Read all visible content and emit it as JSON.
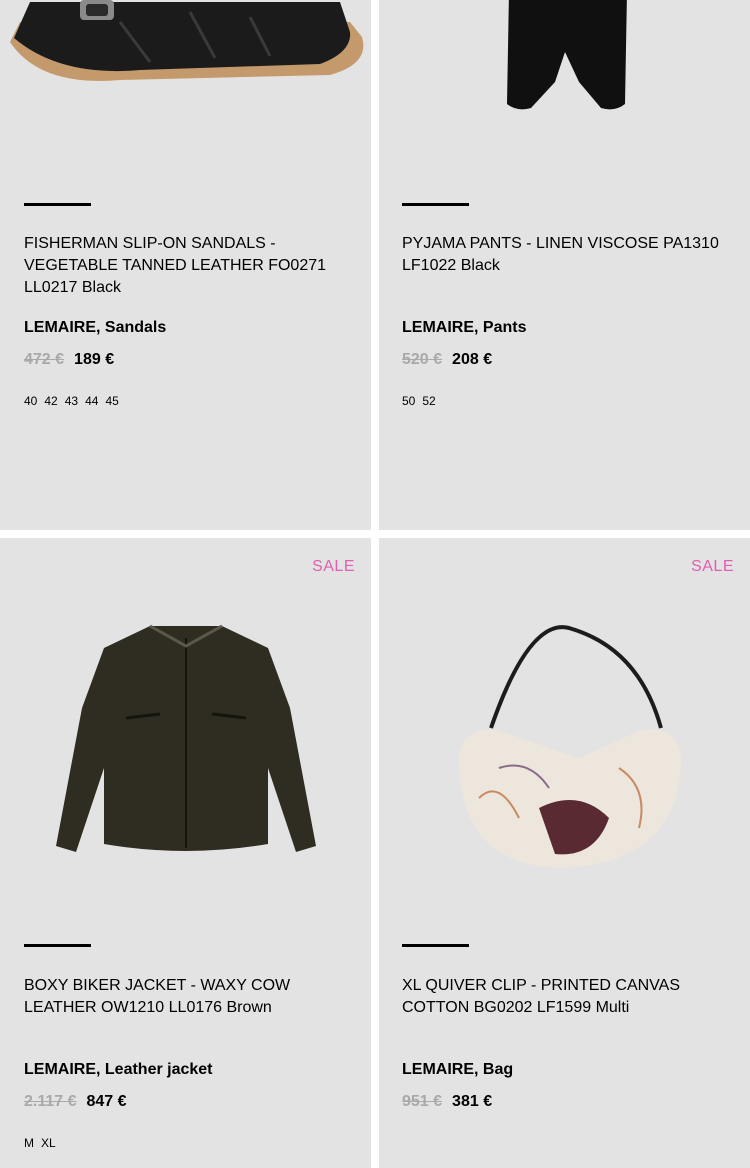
{
  "products": [
    {
      "title": "FISHERMAN SLIP-ON SANDALS - VEGETABLE TANNED LEATHER FO0271 LL0217 Black",
      "brand_line": "LEMAIRE, Sandals",
      "old_price": "472 €",
      "price": "189 €",
      "sizes": [
        "40",
        "42",
        "43",
        "44",
        "45"
      ],
      "sale": null
    },
    {
      "title": "PYJAMA PANTS - LINEN VISCOSE PA1310 LF1022 Black",
      "brand_line": "LEMAIRE, Pants",
      "old_price": "520 €",
      "price": "208 €",
      "sizes": [
        "50",
        "52"
      ],
      "sale": null
    },
    {
      "title": "BOXY BIKER JACKET - WAXY COW LEATHER OW1210 LL0176 Brown",
      "brand_line": "LEMAIRE, Leather jacket",
      "old_price": "2.117 €",
      "price": "847 €",
      "sizes": [
        "M",
        "XL"
      ],
      "sale": "SALE"
    },
    {
      "title": "XL QUIVER CLIP - PRINTED CANVAS COTTON BG0202 LF1599 Multi",
      "brand_line": "LEMAIRE, Bag",
      "old_price": "951 €",
      "price": "381 €",
      "sizes": [],
      "sale": "SALE"
    }
  ],
  "colors": {
    "card_bg": "#e3e3e3",
    "sale": "#e05fae",
    "old_price": "#a9a9a9"
  },
  "icons": [
    "sandal-image",
    "pants-image",
    "jacket-image",
    "bag-image"
  ]
}
